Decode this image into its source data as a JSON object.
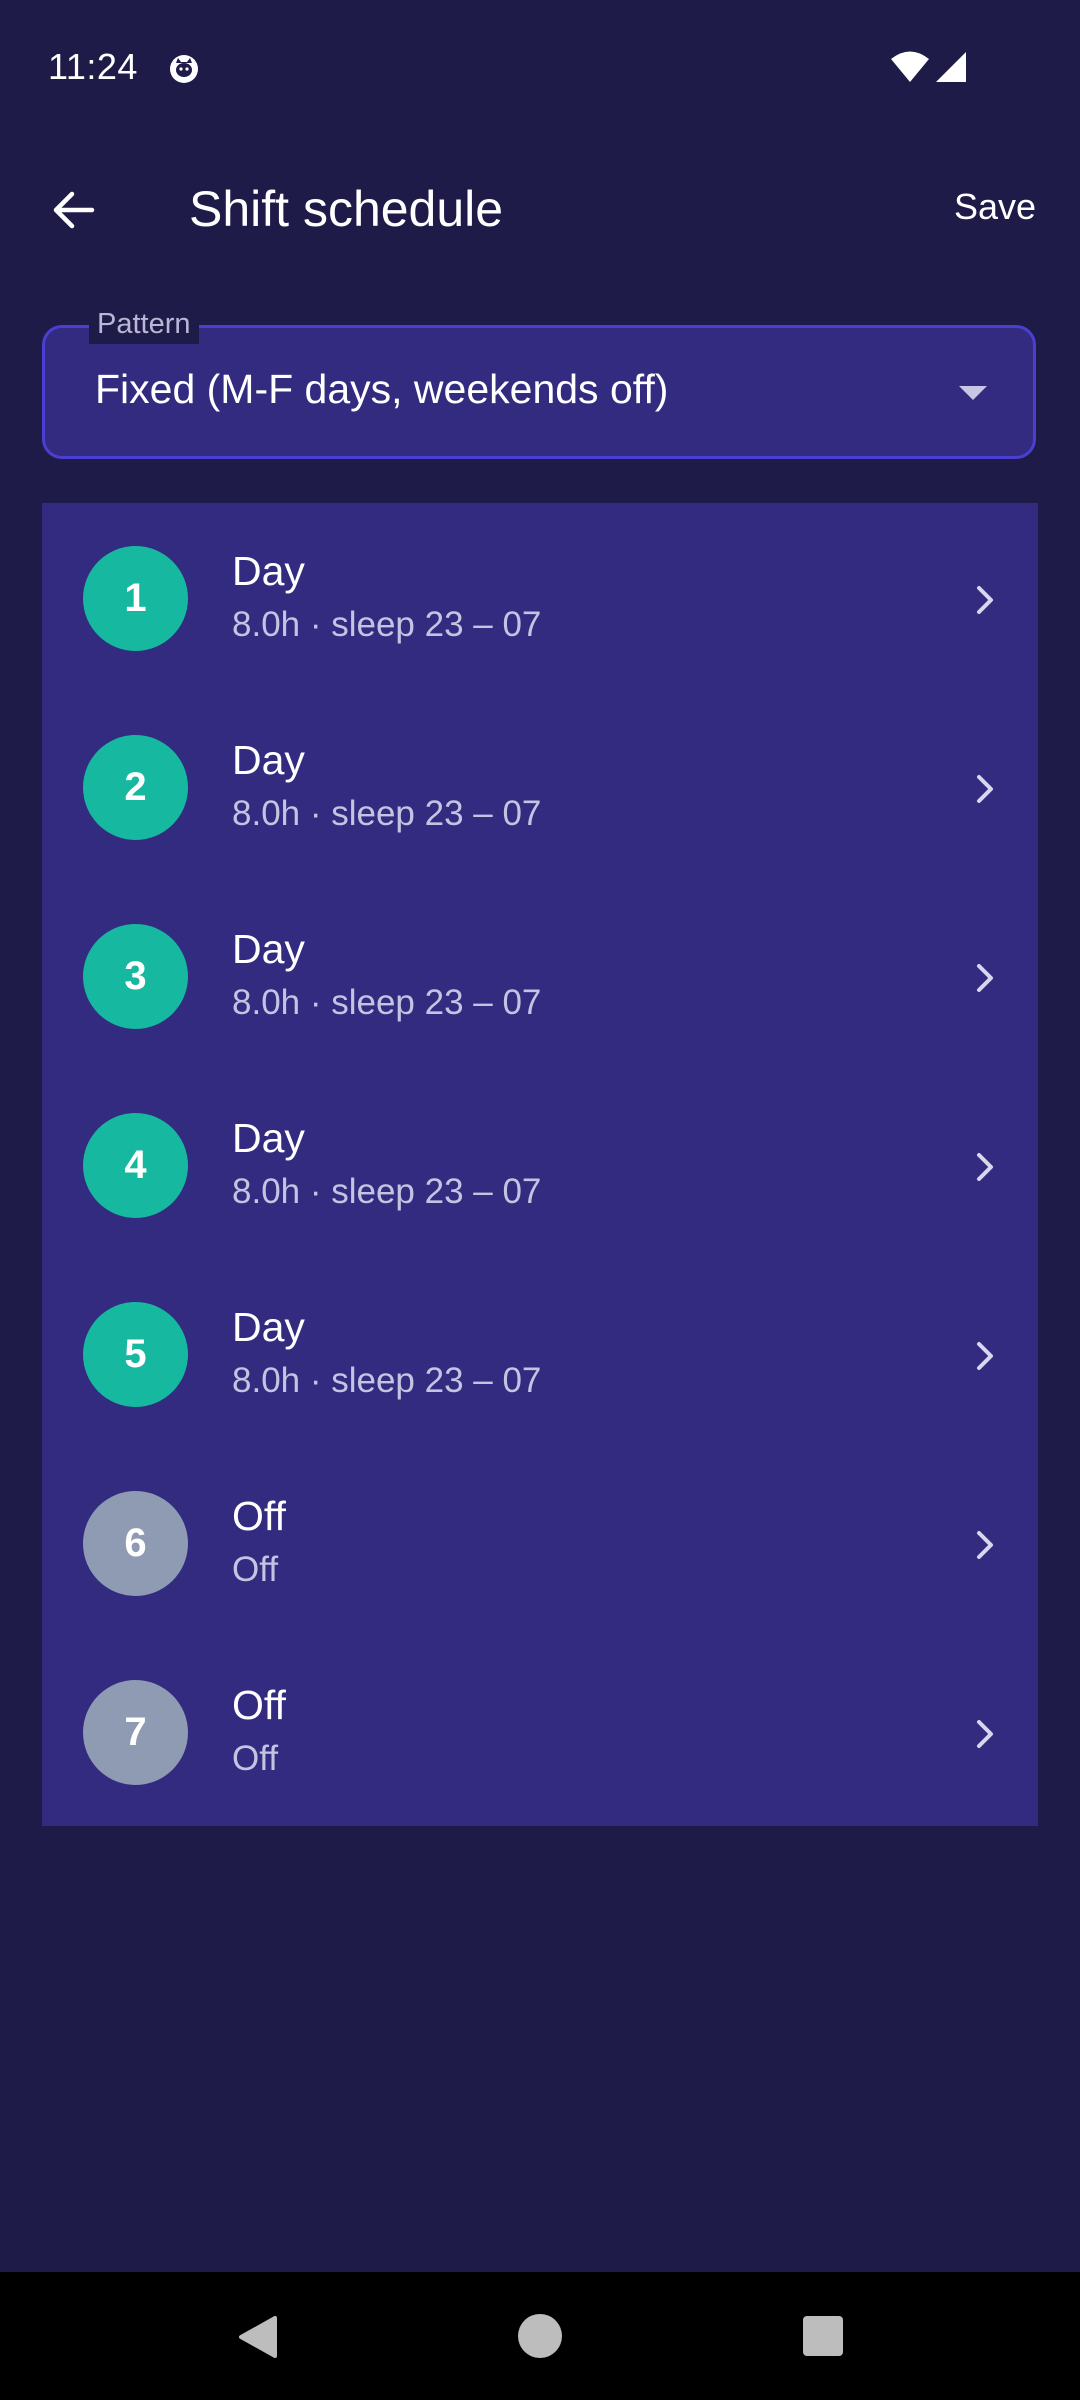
{
  "status_bar": {
    "time": "11:24",
    "icons": [
      "cat-notification-icon",
      "wifi-icon",
      "signal-icon"
    ]
  },
  "app_bar": {
    "title": "Shift schedule",
    "save_label": "Save",
    "back_icon": "arrow-left-icon"
  },
  "pattern": {
    "label": "Pattern",
    "value": "Fixed (M-F days, weekends off)",
    "icon": "dropdown-arrow-icon"
  },
  "days": [
    {
      "number": "1",
      "title": "Day",
      "subtitle": "8.0h · sleep 23 – 07",
      "type": "work"
    },
    {
      "number": "2",
      "title": "Day",
      "subtitle": "8.0h · sleep 23 – 07",
      "type": "work"
    },
    {
      "number": "3",
      "title": "Day",
      "subtitle": "8.0h · sleep 23 – 07",
      "type": "work"
    },
    {
      "number": "4",
      "title": "Day",
      "subtitle": "8.0h · sleep 23 – 07",
      "type": "work"
    },
    {
      "number": "5",
      "title": "Day",
      "subtitle": "8.0h · sleep 23 – 07",
      "type": "work"
    },
    {
      "number": "6",
      "title": "Off",
      "subtitle": "Off",
      "type": "off"
    },
    {
      "number": "7",
      "title": "Off",
      "subtitle": "Off",
      "type": "off"
    }
  ],
  "colors": {
    "background": "#1f1b48",
    "surface": "#322b80",
    "field_border": "#4a3fd1",
    "work_badge": "#17b8a0",
    "off_badge": "#8f9ab3"
  },
  "nav_bar": {
    "icons": [
      "nav-back-icon",
      "nav-home-icon",
      "nav-recents-icon"
    ]
  }
}
